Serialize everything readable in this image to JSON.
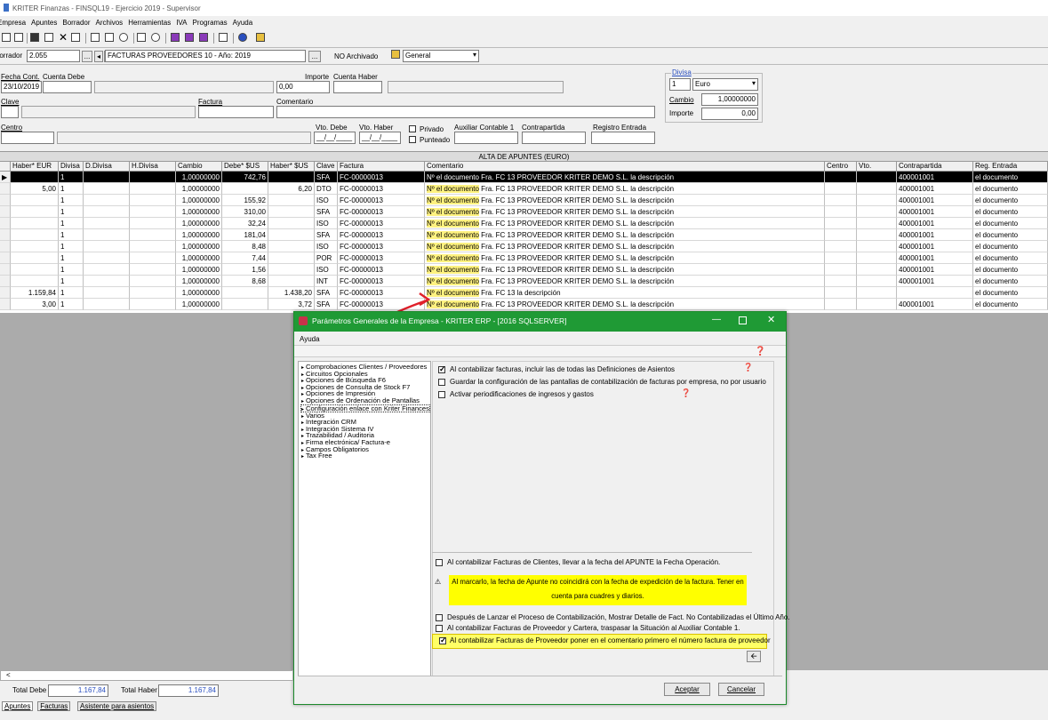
{
  "window_title": "KRITER Finanzas - FINSQL19 - Ejercicio 2019 - Supervisor",
  "menu": [
    "Empresa",
    "Apuntes",
    "Borrador",
    "Archivos",
    "Herramientas",
    "IVA",
    "Programas",
    "Ayuda"
  ],
  "header": {
    "borrador_label": "Borrador",
    "borrador_value": "2.055",
    "btn_dots": "...",
    "btn_prev": "◂",
    "btn_next": "▸",
    "diario": "FACTURAS PROVEEDORES 10 - Año: 2019",
    "btn_dots2": "...",
    "archivado": "NO Archivado",
    "view_select": "General"
  },
  "form": {
    "fecha_label": "Fecha Cont.",
    "fecha_value": "23/10/2019",
    "cuenta_debe_label": "Cuenta Debe",
    "importe_label": "Importe",
    "importe_value": "0,00",
    "cuenta_haber_label": "Cuenta Haber",
    "clave_label": "Clave",
    "factura_label": "Factura",
    "comentario_label": "Comentario",
    "centro_label": "Centro",
    "vto_debe_label": "Vto. Debe",
    "vto_debe_value": "__/__/____",
    "vto_haber_label": "Vto. Haber",
    "vto_haber_value": "__/__/____",
    "privado_label": "Privado",
    "punteado_label": "Punteado",
    "aux_label": "Auxiliar Contable 1",
    "contrapartida_label": "Contrapartida",
    "registro_label": "Registro Entrada"
  },
  "divisa": {
    "group_label": "Divisa",
    "code": "1",
    "name": "Euro",
    "cambio_label": "Cambio",
    "cambio_value": "1,00000000",
    "importe_label": "Importe",
    "importe_value": "0,00"
  },
  "grid": {
    "title": "ALTA DE APUNTES (EURO)",
    "columns": [
      "Haber* EUR",
      "Divisa",
      "D.Divisa",
      "H.Divisa",
      "Cambio",
      "Debe* $US",
      "Haber* $US",
      "Clave",
      "Factura",
      "Comentario",
      "Centro",
      "Vto.",
      "Contrapartida",
      "Reg. Entrada"
    ],
    "rows": [
      {
        "haber": "",
        "divisa": "1",
        "cambio": "1,00000000",
        "debe_us": "742,76",
        "haber_us": "",
        "clave": "SFA",
        "factura": "FC-00000013",
        "com_a": "Nº el documento",
        "com_b": "Fra. FC 13 PROVEEDOR KRITER DEMO  S.L. la descripción",
        "contra": "400001001",
        "reg": "el documento"
      },
      {
        "haber": "5,00",
        "divisa": "1",
        "cambio": "1,00000000",
        "debe_us": "",
        "haber_us": "6,20",
        "clave": "DTO",
        "factura": "FC-00000013",
        "com_a": "Nº el documento",
        "com_b": "Fra. FC 13 PROVEEDOR KRITER DEMO  S.L. la descripción",
        "contra": "400001001",
        "reg": "el documento"
      },
      {
        "haber": "",
        "divisa": "1",
        "cambio": "1,00000000",
        "debe_us": "155,92",
        "haber_us": "",
        "clave": "ISO",
        "factura": "FC-00000013",
        "com_a": "Nº el documento",
        "com_b": "Fra. FC 13 PROVEEDOR KRITER DEMO  S.L. la descripción",
        "contra": "400001001",
        "reg": "el documento"
      },
      {
        "haber": "",
        "divisa": "1",
        "cambio": "1,00000000",
        "debe_us": "310,00",
        "haber_us": "",
        "clave": "SFA",
        "factura": "FC-00000013",
        "com_a": "Nº el documento",
        "com_b": "Fra. FC 13 PROVEEDOR KRITER DEMO  S.L. la descripción",
        "contra": "400001001",
        "reg": "el documento"
      },
      {
        "haber": "",
        "divisa": "1",
        "cambio": "1,00000000",
        "debe_us": "32,24",
        "haber_us": "",
        "clave": "ISO",
        "factura": "FC-00000013",
        "com_a": "Nº el documento",
        "com_b": "Fra. FC 13 PROVEEDOR KRITER DEMO  S.L. la descripción",
        "contra": "400001001",
        "reg": "el documento"
      },
      {
        "haber": "",
        "divisa": "1",
        "cambio": "1,00000000",
        "debe_us": "181,04",
        "haber_us": "",
        "clave": "SFA",
        "factura": "FC-00000013",
        "com_a": "Nº el documento",
        "com_b": "Fra. FC 13 PROVEEDOR KRITER DEMO  S.L. la descripción",
        "contra": "400001001",
        "reg": "el documento"
      },
      {
        "haber": "",
        "divisa": "1",
        "cambio": "1,00000000",
        "debe_us": "8,48",
        "haber_us": "",
        "clave": "ISO",
        "factura": "FC-00000013",
        "com_a": "Nº el documento",
        "com_b": "Fra. FC 13 PROVEEDOR KRITER DEMO  S.L. la descripción",
        "contra": "400001001",
        "reg": "el documento"
      },
      {
        "haber": "",
        "divisa": "1",
        "cambio": "1,00000000",
        "debe_us": "7,44",
        "haber_us": "",
        "clave": "POR",
        "factura": "FC-00000013",
        "com_a": "Nº el documento",
        "com_b": "Fra. FC 13 PROVEEDOR KRITER DEMO  S.L. la descripción",
        "contra": "400001001",
        "reg": "el documento"
      },
      {
        "haber": "",
        "divisa": "1",
        "cambio": "1,00000000",
        "debe_us": "1,56",
        "haber_us": "",
        "clave": "ISO",
        "factura": "FC-00000013",
        "com_a": "Nº el documento",
        "com_b": "Fra. FC 13 PROVEEDOR KRITER DEMO  S.L. la descripción",
        "contra": "400001001",
        "reg": "el documento"
      },
      {
        "haber": "",
        "divisa": "1",
        "cambio": "1,00000000",
        "debe_us": "8,68",
        "haber_us": "",
        "clave": "INT",
        "factura": "FC-00000013",
        "com_a": "Nº el documento",
        "com_b": "Fra. FC 13 PROVEEDOR KRITER DEMO  S.L. la descripción",
        "contra": "400001001",
        "reg": "el documento"
      },
      {
        "haber": "1.159,84",
        "divisa": "1",
        "cambio": "1,00000000",
        "debe_us": "",
        "haber_us": "1.438,20",
        "clave": "SFA",
        "factura": "FC-00000013",
        "com_a": "Nº el documento",
        "com_b": "Fra. FC 13 la descripción",
        "contra": "",
        "reg": "el documento"
      },
      {
        "haber": "3,00",
        "divisa": "1",
        "cambio": "1,00000000",
        "debe_us": "",
        "haber_us": "3,72",
        "clave": "SFA",
        "factura": "FC-00000013",
        "com_a": "Nº el documento",
        "com_b": "Fra. FC 13 PROVEEDOR KRITER DEMO  S.L. la descripción",
        "contra": "400001001",
        "reg": "el documento"
      }
    ]
  },
  "dialog": {
    "title": "Parámetros Generales de la Empresa - KRITER ERP - [2016 SQLSERVER]",
    "menu": "Ayuda",
    "tree": [
      "Comprobaciones Clientes / Proveedores",
      "Circuitos Opcionales",
      "Opciones de Búsqueda F6",
      "Opciones de Consulta de Stock F7",
      "Opciones de Impresión",
      "Opciones de Ordenación de Pantallas",
      "Configuración enlace con Kriter Finances",
      "Varios",
      "Integración CRM",
      "Integración Sistema IV",
      "Trazabilidad / Auditoria",
      "Firma electrónica/ Factura-e",
      "Campos Obligatorios",
      "Tax Free"
    ],
    "top_options": [
      "Al contabilizar facturas, incluir las de todas las Definiciones de Asientos",
      "Guardar la configuración de las pantallas de contabilización de facturas por empresa, no por usuario",
      "Activar periodificaciones de ingresos y gastos"
    ],
    "opt_clientes": "Al contabilizar Facturas de Clientes, llevar a la fecha del APUNTE la Fecha Operación.",
    "warning_1": "Al marcarlo, la fecha de Apunte no coincidirá con la fecha de expedición de la factura. Tener en",
    "warning_2": "cuenta para cuadres y diarios.",
    "opt_detalle": "Después de Lanzar el Proceso de Contabilización, Mostrar Detalle de Fact. No Contabilizadas el Último Año.",
    "opt_cartera": "Al contabilizar Facturas de Proveedor y Cartera, traspasar la Situación al Auxiliar Contable 1.",
    "opt_proveedor": "Al contabilizar Facturas de Proveedor poner en el comentario primero el número factura de proveedor",
    "accept": "Aceptar",
    "cancel": "Cancelar",
    "back": "🡨"
  },
  "footer": {
    "total_debe_label": "Total Debe",
    "total_debe": "1.167,84",
    "total_haber_label": "Total Haber",
    "total_haber": "1.167,84",
    "tabs": [
      "Apuntes",
      "Facturas",
      "Asistente para asientos"
    ],
    "scroll_left": "<"
  },
  "colors": {
    "dialog_title": "#1f9a35",
    "highlight": "#fff280",
    "arrow": "#e0202a"
  }
}
